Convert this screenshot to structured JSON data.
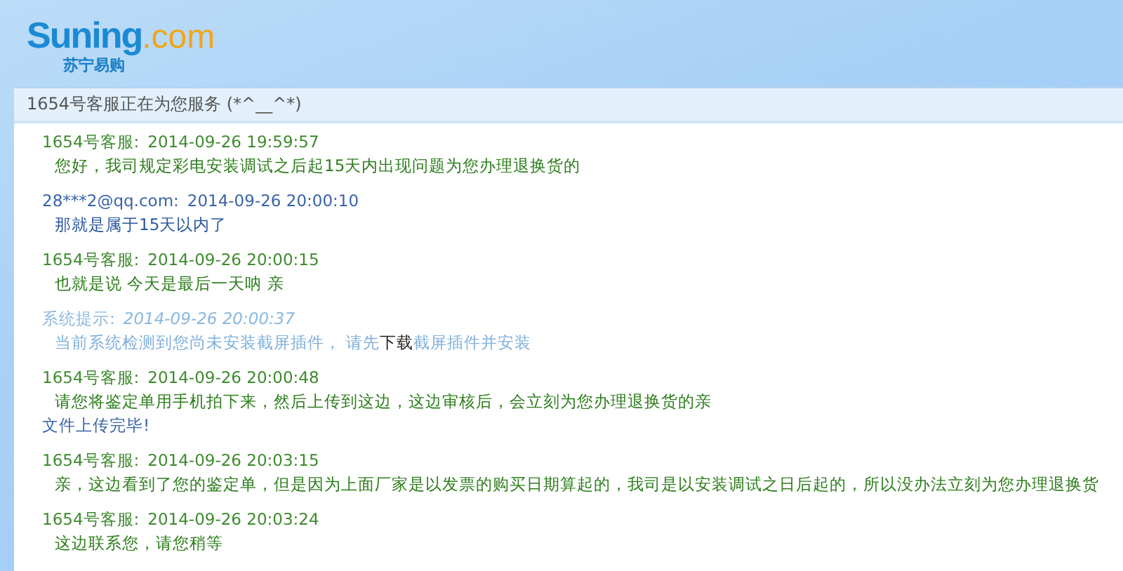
{
  "logo": {
    "brand": "Suning",
    "suffix": ".com",
    "subtitle": "苏宁易购"
  },
  "panel": {
    "title": "1654号客服正在为您服务 (*^__^*)"
  },
  "messages": [
    {
      "kind": "agent",
      "sender": "1654号客服:",
      "time": "2014-09-26 19:59:57",
      "body": [
        {
          "kind": "plain",
          "text": "您好，我司规定彩电安装调试之后起15天内出现问题为您办理退换货的"
        }
      ]
    },
    {
      "kind": "user",
      "sender": "28***2@qq.com:",
      "time": "2014-09-26 20:00:10",
      "body": [
        {
          "kind": "plain",
          "text": "那就是属于15天以内了"
        }
      ]
    },
    {
      "kind": "agent",
      "sender": "1654号客服:",
      "time": "2014-09-26 20:00:15",
      "body": [
        {
          "kind": "plain",
          "text": "也就是说 今天是最后一天呐 亲"
        }
      ]
    },
    {
      "kind": "system",
      "sender": "系统提示:",
      "time": "2014-09-26 20:00:37",
      "body": [
        {
          "kind": "plain",
          "text": "当前系统检测到您尚未安装截屏插件， 请先"
        },
        {
          "kind": "link",
          "text": "下载"
        },
        {
          "kind": "plain",
          "text": "截屏插件并安装"
        }
      ]
    },
    {
      "kind": "agent",
      "sender": "1654号客服:",
      "time": "2014-09-26 20:00:48",
      "body": [
        {
          "kind": "plain",
          "text": "请您将鉴定单用手机拍下来，然后上传到这边，这边审核后，会立刻为您办理退换货的亲"
        }
      ],
      "note": "文件上传完毕!"
    },
    {
      "kind": "agent",
      "sender": "1654号客服:",
      "time": "2014-09-26 20:03:15",
      "body": [
        {
          "kind": "plain",
          "text": "亲，这边看到了您的鉴定单，但是因为上面厂家是以发票的购买日期算起的，我司是以安装调试之日后起的，所以没办法立刻为您办理退换货"
        }
      ]
    },
    {
      "kind": "agent",
      "sender": "1654号客服:",
      "time": "2014-09-26 20:03:24",
      "body": [
        {
          "kind": "plain",
          "text": "这边联系您，请您稍等"
        }
      ]
    }
  ]
}
